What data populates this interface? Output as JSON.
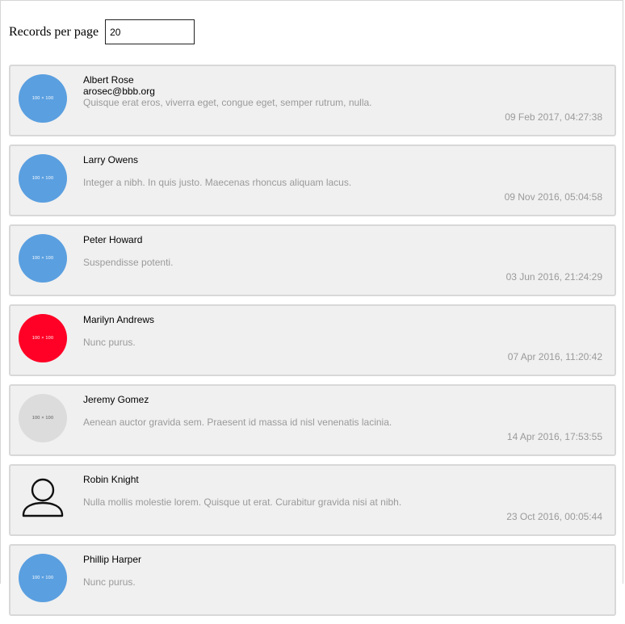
{
  "controls": {
    "records_per_page_label": "Records per page",
    "records_per_page_value": "20"
  },
  "records": [
    {
      "name": "Albert Rose",
      "email": "arosec@bbb.org",
      "message": "Quisque erat eros, viverra eget, congue eget, semper rutrum, nulla.",
      "date": "09 Feb 2017, 04:27:38",
      "avatar_text": "100 × 100",
      "avatar_color": "#5a9fe0"
    },
    {
      "name": "Larry Owens",
      "email": "",
      "message": "Integer a nibh. In quis justo. Maecenas rhoncus aliquam lacus.",
      "date": "09 Nov 2016, 05:04:58",
      "avatar_text": "100 × 100",
      "avatar_color": "#5a9fe0"
    },
    {
      "name": "Peter Howard",
      "email": "",
      "message": "Suspendisse potenti.",
      "date": "03 Jun 2016, 21:24:29",
      "avatar_text": "100 × 100",
      "avatar_color": "#5a9fe0"
    },
    {
      "name": "Marilyn Andrews",
      "email": "",
      "message": "Nunc purus.",
      "date": "07 Apr 2016, 11:20:42",
      "avatar_text": "100 × 100",
      "avatar_color": "#ff0026"
    },
    {
      "name": "Jeremy Gomez",
      "email": "",
      "message": "Aenean auctor gravida sem. Praesent id massa id nisl venenatis lacinia.",
      "date": "14 Apr 2016, 17:53:55",
      "avatar_text": "100 × 100",
      "avatar_color": "#dcdcdc",
      "avatar_text_color": "#555555"
    },
    {
      "name": "Robin Knight",
      "email": "",
      "message": "Nulla mollis molestie lorem. Quisque ut erat. Curabitur gravida nisi at nibh.",
      "date": "23 Oct 2016, 00:05:44",
      "avatar_icon": "user-outline-icon"
    },
    {
      "name": "Phillip Harper",
      "email": "",
      "message": "Nunc purus.",
      "date": "",
      "avatar_text": "100 × 100",
      "avatar_color": "#5a9fe0"
    }
  ]
}
